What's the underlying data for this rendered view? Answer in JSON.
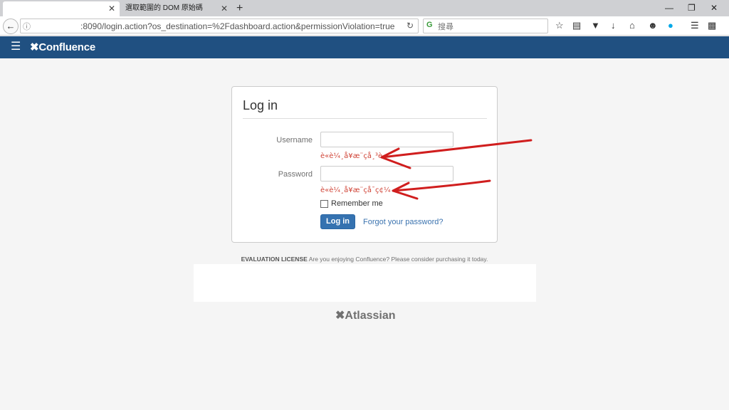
{
  "browser": {
    "tabs": [
      {
        "label": ""
      },
      {
        "label": "選取範圍的 DOM 原始碼"
      }
    ],
    "new_tab_label": "+",
    "tab_close_glyph": "✕",
    "window_controls": {
      "minimize": "—",
      "restore": "❐",
      "close": "✕"
    },
    "address_bar": {
      "url": ":8090/login.action?os_destination=%2Fdashboard.action&permissionViolation=true"
    },
    "search": {
      "placeholder": "搜尋"
    },
    "toolbar_icons": [
      "star-icon",
      "reader-icon",
      "pocket-icon",
      "download-icon",
      "home-icon",
      "emoji-icon",
      "skype-icon",
      "menu-icon",
      "extension-icon"
    ]
  },
  "app": {
    "name": "Confluence",
    "header_bg": "#205081"
  },
  "login": {
    "title": "Log in",
    "username_label": "Username",
    "username_value": "",
    "username_error": "è«è¼¸å¥æ¨çå¸³è",
    "password_label": "Password",
    "password_value": "",
    "password_error": "è«è¼¸å¥æ¨çå¯ç¢¼",
    "remember_label": "Remember me",
    "submit_label": "Log in",
    "forgot_label": "Forgot your password?",
    "primary_color": "#3572b0",
    "error_color": "#d04437"
  },
  "footer": {
    "license_bold": "EVALUATION LICENSE",
    "license_text": " Are you enjoying Confluence? Please consider purchasing it today.",
    "brand": "Atlassian"
  },
  "annotations": {
    "arrow_color": "#d01e1e"
  }
}
